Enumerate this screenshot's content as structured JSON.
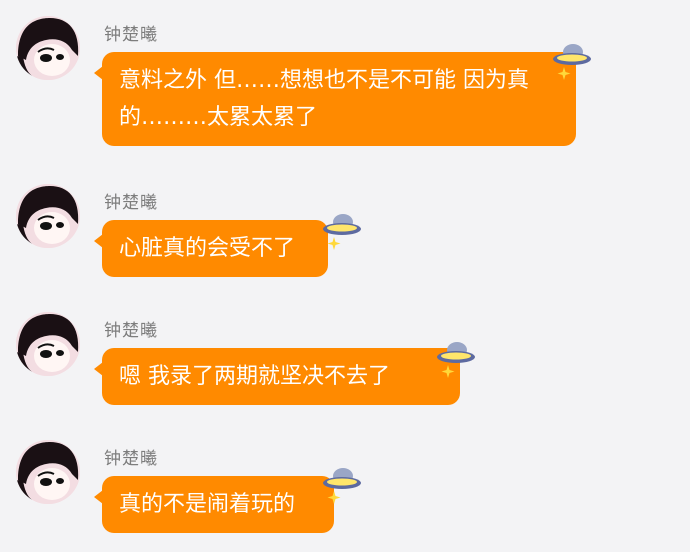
{
  "messages": [
    {
      "sender": "钟楚曦",
      "text": "意料之外 但……想想也不是不可能 因为真的………太累太累了"
    },
    {
      "sender": "钟楚曦",
      "text": "心脏真的会受不了"
    },
    {
      "sender": "钟楚曦",
      "text": "嗯 我录了两期就坚决不去了"
    },
    {
      "sender": "钟楚曦",
      "text": "真的不是闹着玩的"
    }
  ],
  "colors": {
    "bubble": "#ff8a00",
    "bubble_text": "#ffffff",
    "sender": "#7d7d7d",
    "background": "#f3f3f5"
  },
  "icons": {
    "avatar": "avatar-portrait",
    "bubble_decoration": "ufo-sparkle-icon"
  }
}
